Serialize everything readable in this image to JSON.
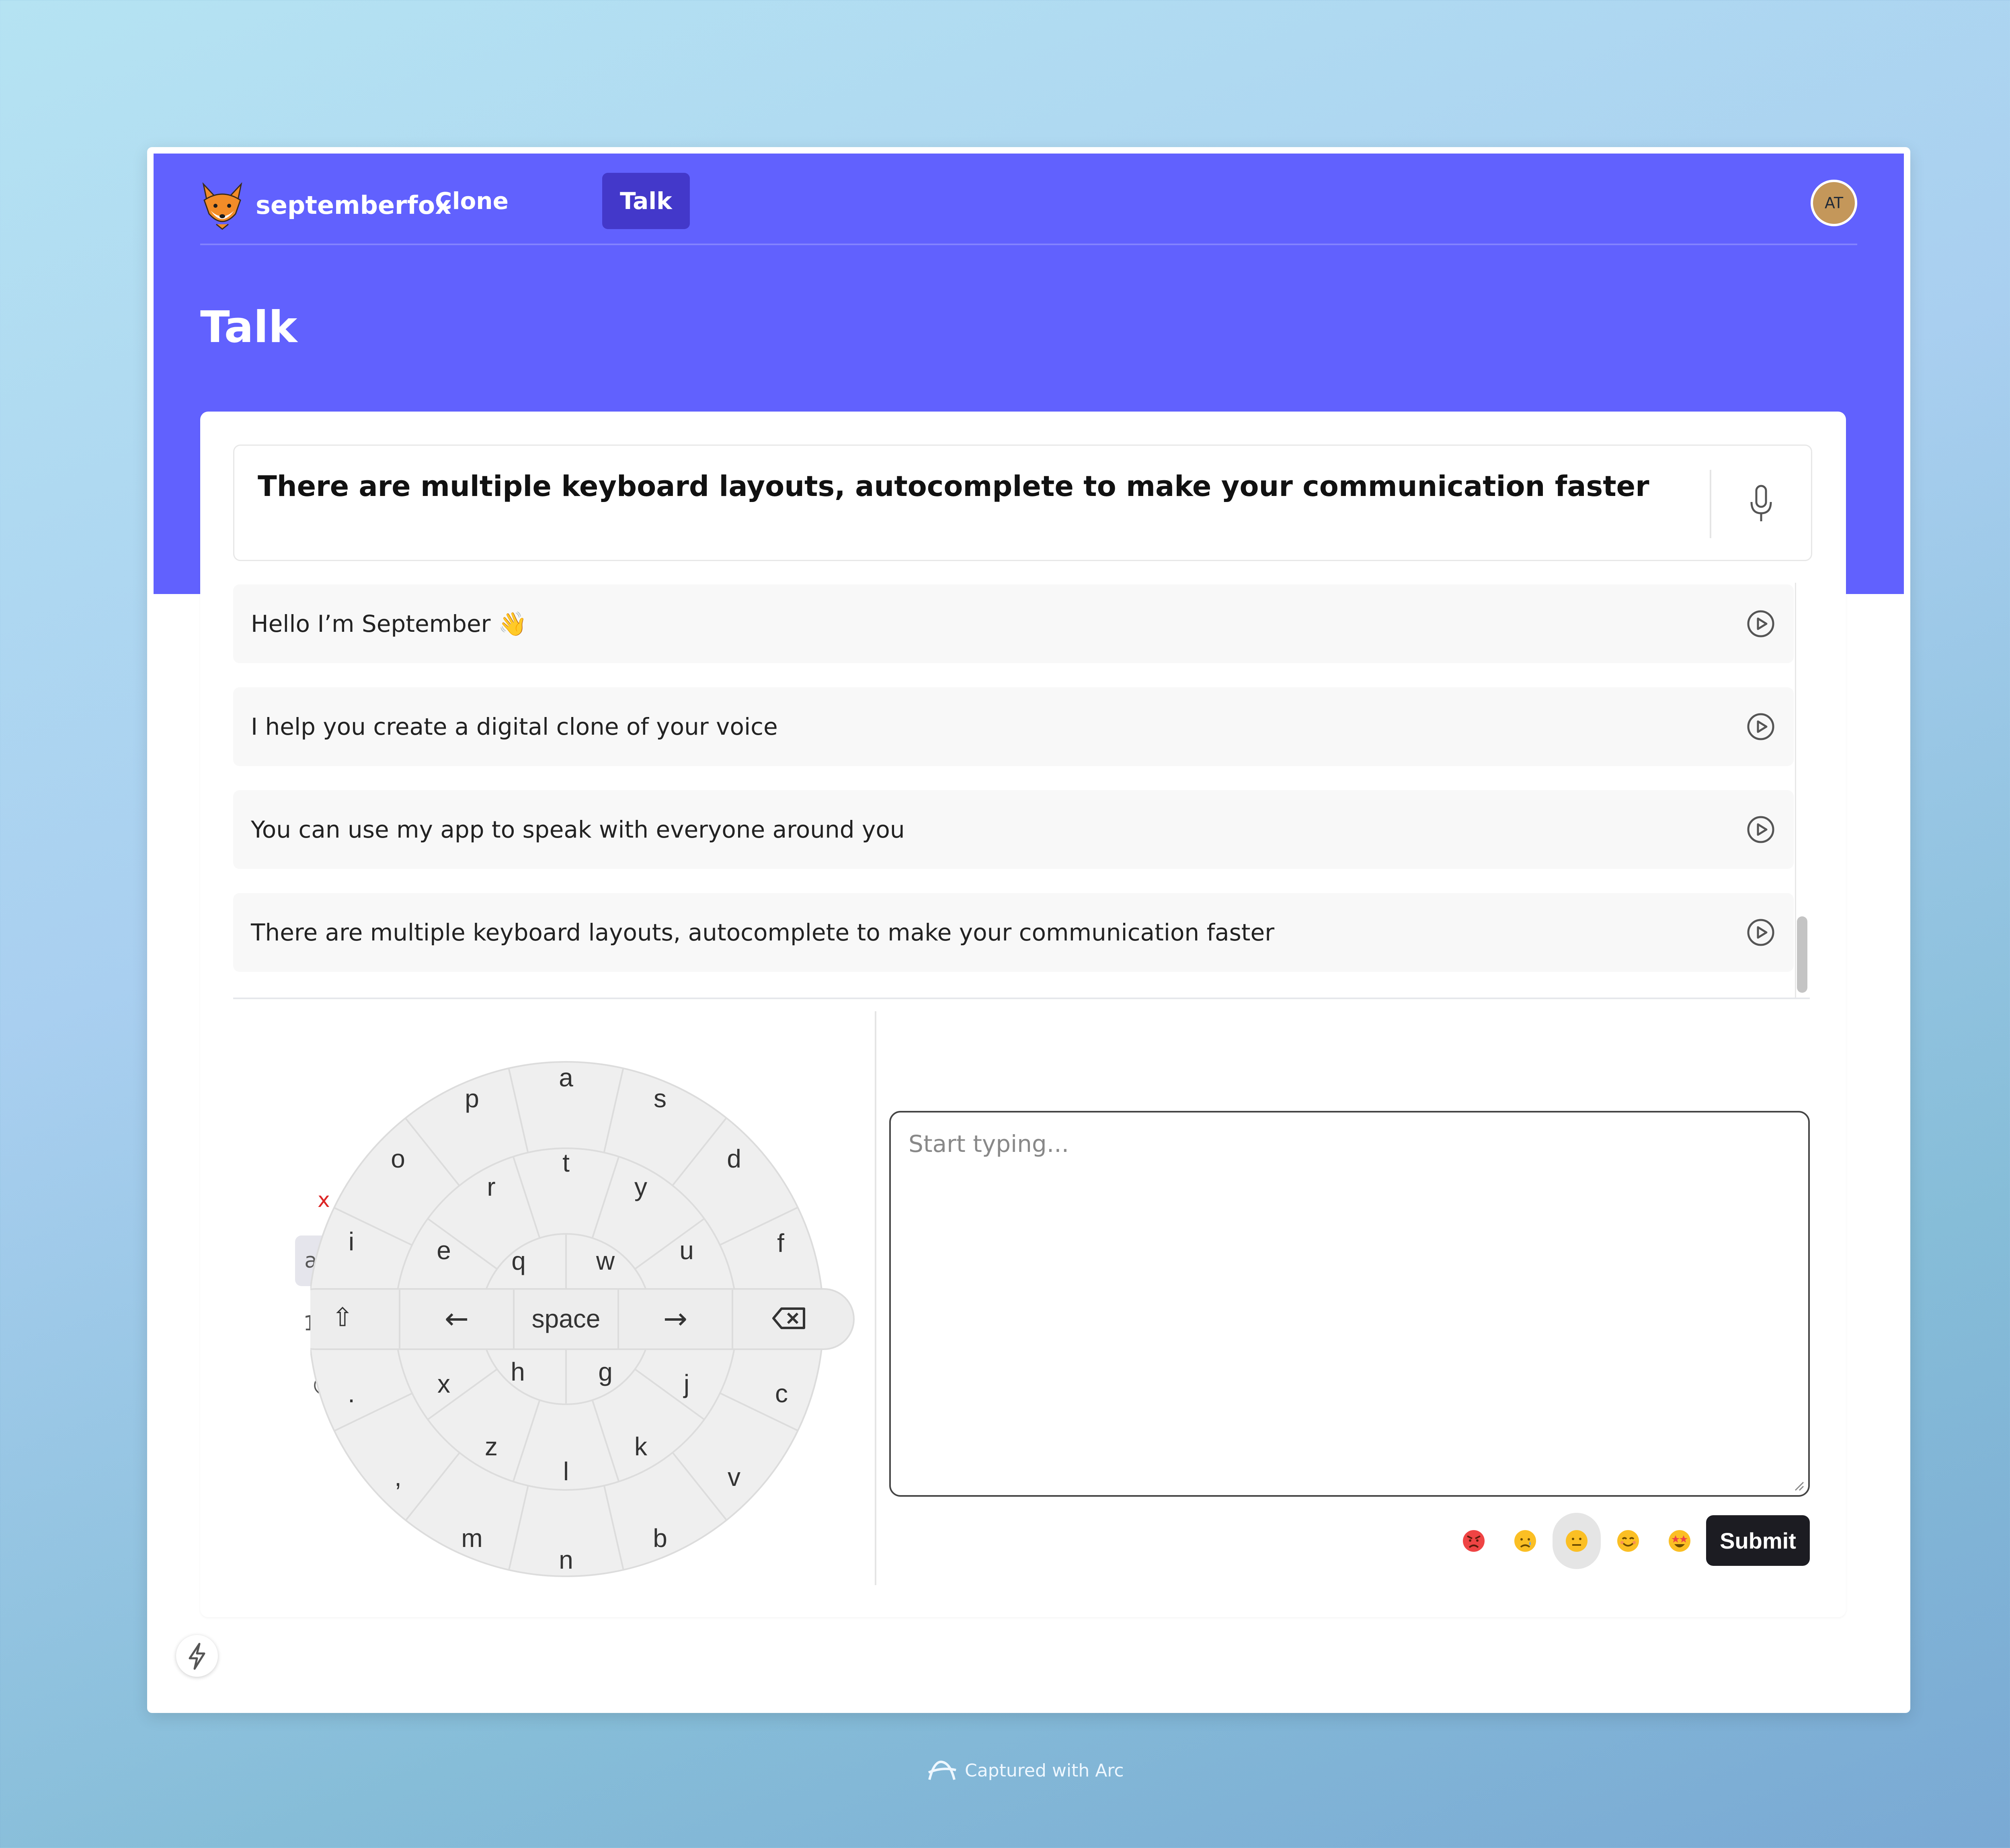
{
  "app": {
    "brand": "septemberfox",
    "avatar_initials": "AT",
    "accent": "#6161fe",
    "active_nav_bg": "#4338ca",
    "logo_icon": "fox-logo-icon"
  },
  "nav": {
    "items": [
      {
        "label": "Clone",
        "active": false
      },
      {
        "label": "Talk",
        "active": true
      }
    ]
  },
  "page": {
    "title": "Talk"
  },
  "output": {
    "text": "There are multiple keyboard layouts, autocomplete to make your communication faster",
    "mic_icon": "microphone-icon"
  },
  "history": {
    "items": [
      {
        "text": "Hello I’m September 👋",
        "icon": "play-circle-icon"
      },
      {
        "text": "I help you create a digital clone of your voice",
        "icon": "play-circle-icon"
      },
      {
        "text": "You can use my app to speak with everyone around you",
        "icon": "play-circle-icon"
      },
      {
        "text": "There are multiple keyboard layouts, autocomplete to make your communication faster",
        "icon": "play-circle-icon"
      }
    ]
  },
  "keyboard": {
    "modes": {
      "close": "x",
      "abc": "abc",
      "numbers": "123",
      "emoji": "😎"
    },
    "active_mode": "abc",
    "outer_ring": [
      "a",
      "s",
      "d",
      "f",
      "c",
      "v",
      "b",
      "n",
      "m",
      ",",
      ".",
      "i",
      "o",
      "p"
    ],
    "middle_ring": [
      "t",
      "y",
      "u",
      "j",
      "k",
      "l",
      "z",
      "x",
      "e",
      "r"
    ],
    "inner_ring": [
      "q",
      "w",
      "h",
      "g"
    ],
    "control_row": {
      "shift": "⇧",
      "left": "←",
      "space": "space",
      "right": "→",
      "backspace": "backspace-icon"
    }
  },
  "input": {
    "placeholder": "Start typing..."
  },
  "moods": {
    "items": [
      "angry",
      "sad",
      "neutral",
      "happy",
      "excited"
    ],
    "selected": "neutral"
  },
  "actions": {
    "submit": "Submit"
  },
  "footer": {
    "caption": "Captured with Arc"
  }
}
